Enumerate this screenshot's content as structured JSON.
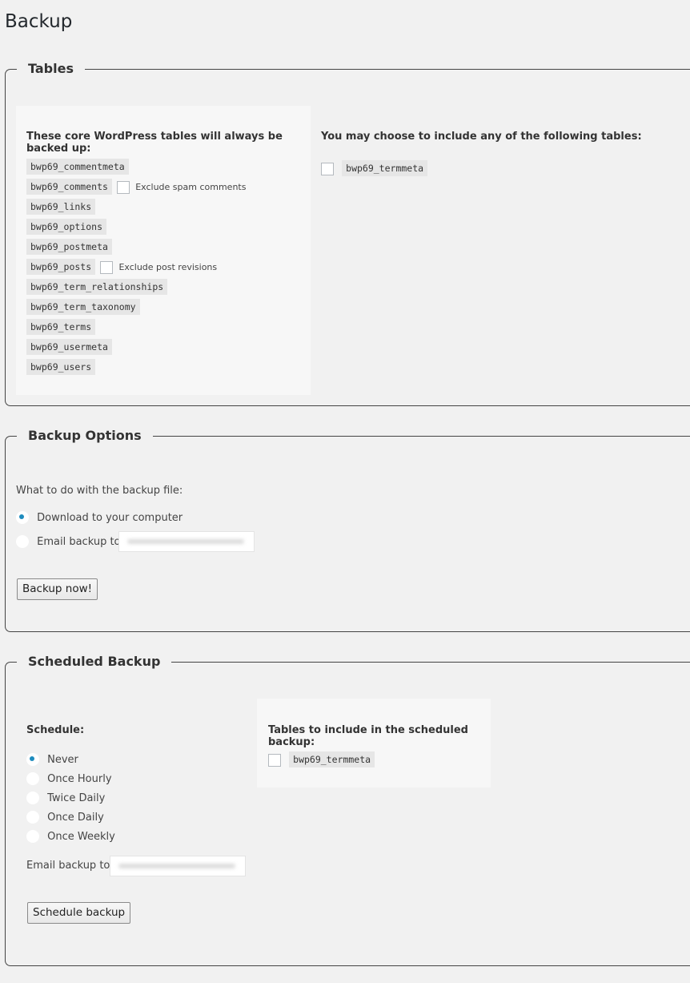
{
  "page": {
    "title": "Backup"
  },
  "tables": {
    "legend": "Tables",
    "core_heading": "These core WordPress tables will always be backed up:",
    "core_tables": [
      {
        "name": "bwp69_commentmeta"
      },
      {
        "name": "bwp69_comments",
        "option_label": "Exclude spam comments",
        "option_checked": false
      },
      {
        "name": "bwp69_links"
      },
      {
        "name": "bwp69_options"
      },
      {
        "name": "bwp69_postmeta"
      },
      {
        "name": "bwp69_posts",
        "option_label": "Exclude post revisions",
        "option_checked": false
      },
      {
        "name": "bwp69_term_relationships"
      },
      {
        "name": "bwp69_term_taxonomy"
      },
      {
        "name": "bwp69_terms"
      },
      {
        "name": "bwp69_usermeta"
      },
      {
        "name": "bwp69_users"
      }
    ],
    "optional_heading": "You may choose to include any of the following tables:",
    "optional_tables": [
      {
        "name": "bwp69_termmeta",
        "checked": false
      }
    ]
  },
  "backup_options": {
    "legend": "Backup Options",
    "question": "What to do with the backup file:",
    "options": [
      {
        "label": "Download to your computer",
        "selected": true
      },
      {
        "label": "Email backup to:",
        "selected": false
      }
    ],
    "email_value": "(blurred)",
    "button_label": "Backup now!"
  },
  "scheduled": {
    "legend": "Scheduled Backup",
    "schedule_heading": "Schedule:",
    "options": [
      {
        "label": "Never",
        "selected": true
      },
      {
        "label": "Once Hourly",
        "selected": false
      },
      {
        "label": "Twice Daily",
        "selected": false
      },
      {
        "label": "Once Daily",
        "selected": false
      },
      {
        "label": "Once Weekly",
        "selected": false
      }
    ],
    "email_label": "Email backup to:",
    "email_value": "(blurred)",
    "tables_heading": "Tables to include in the scheduled backup:",
    "tables": [
      {
        "name": "bwp69_termmeta",
        "checked": false
      }
    ],
    "button_label": "Schedule backup"
  },
  "colors": {
    "accent": "#1e8cbe",
    "background": "#f1f1f1",
    "panel": "#f7f7f7",
    "code_bg": "#e6e6e6"
  }
}
